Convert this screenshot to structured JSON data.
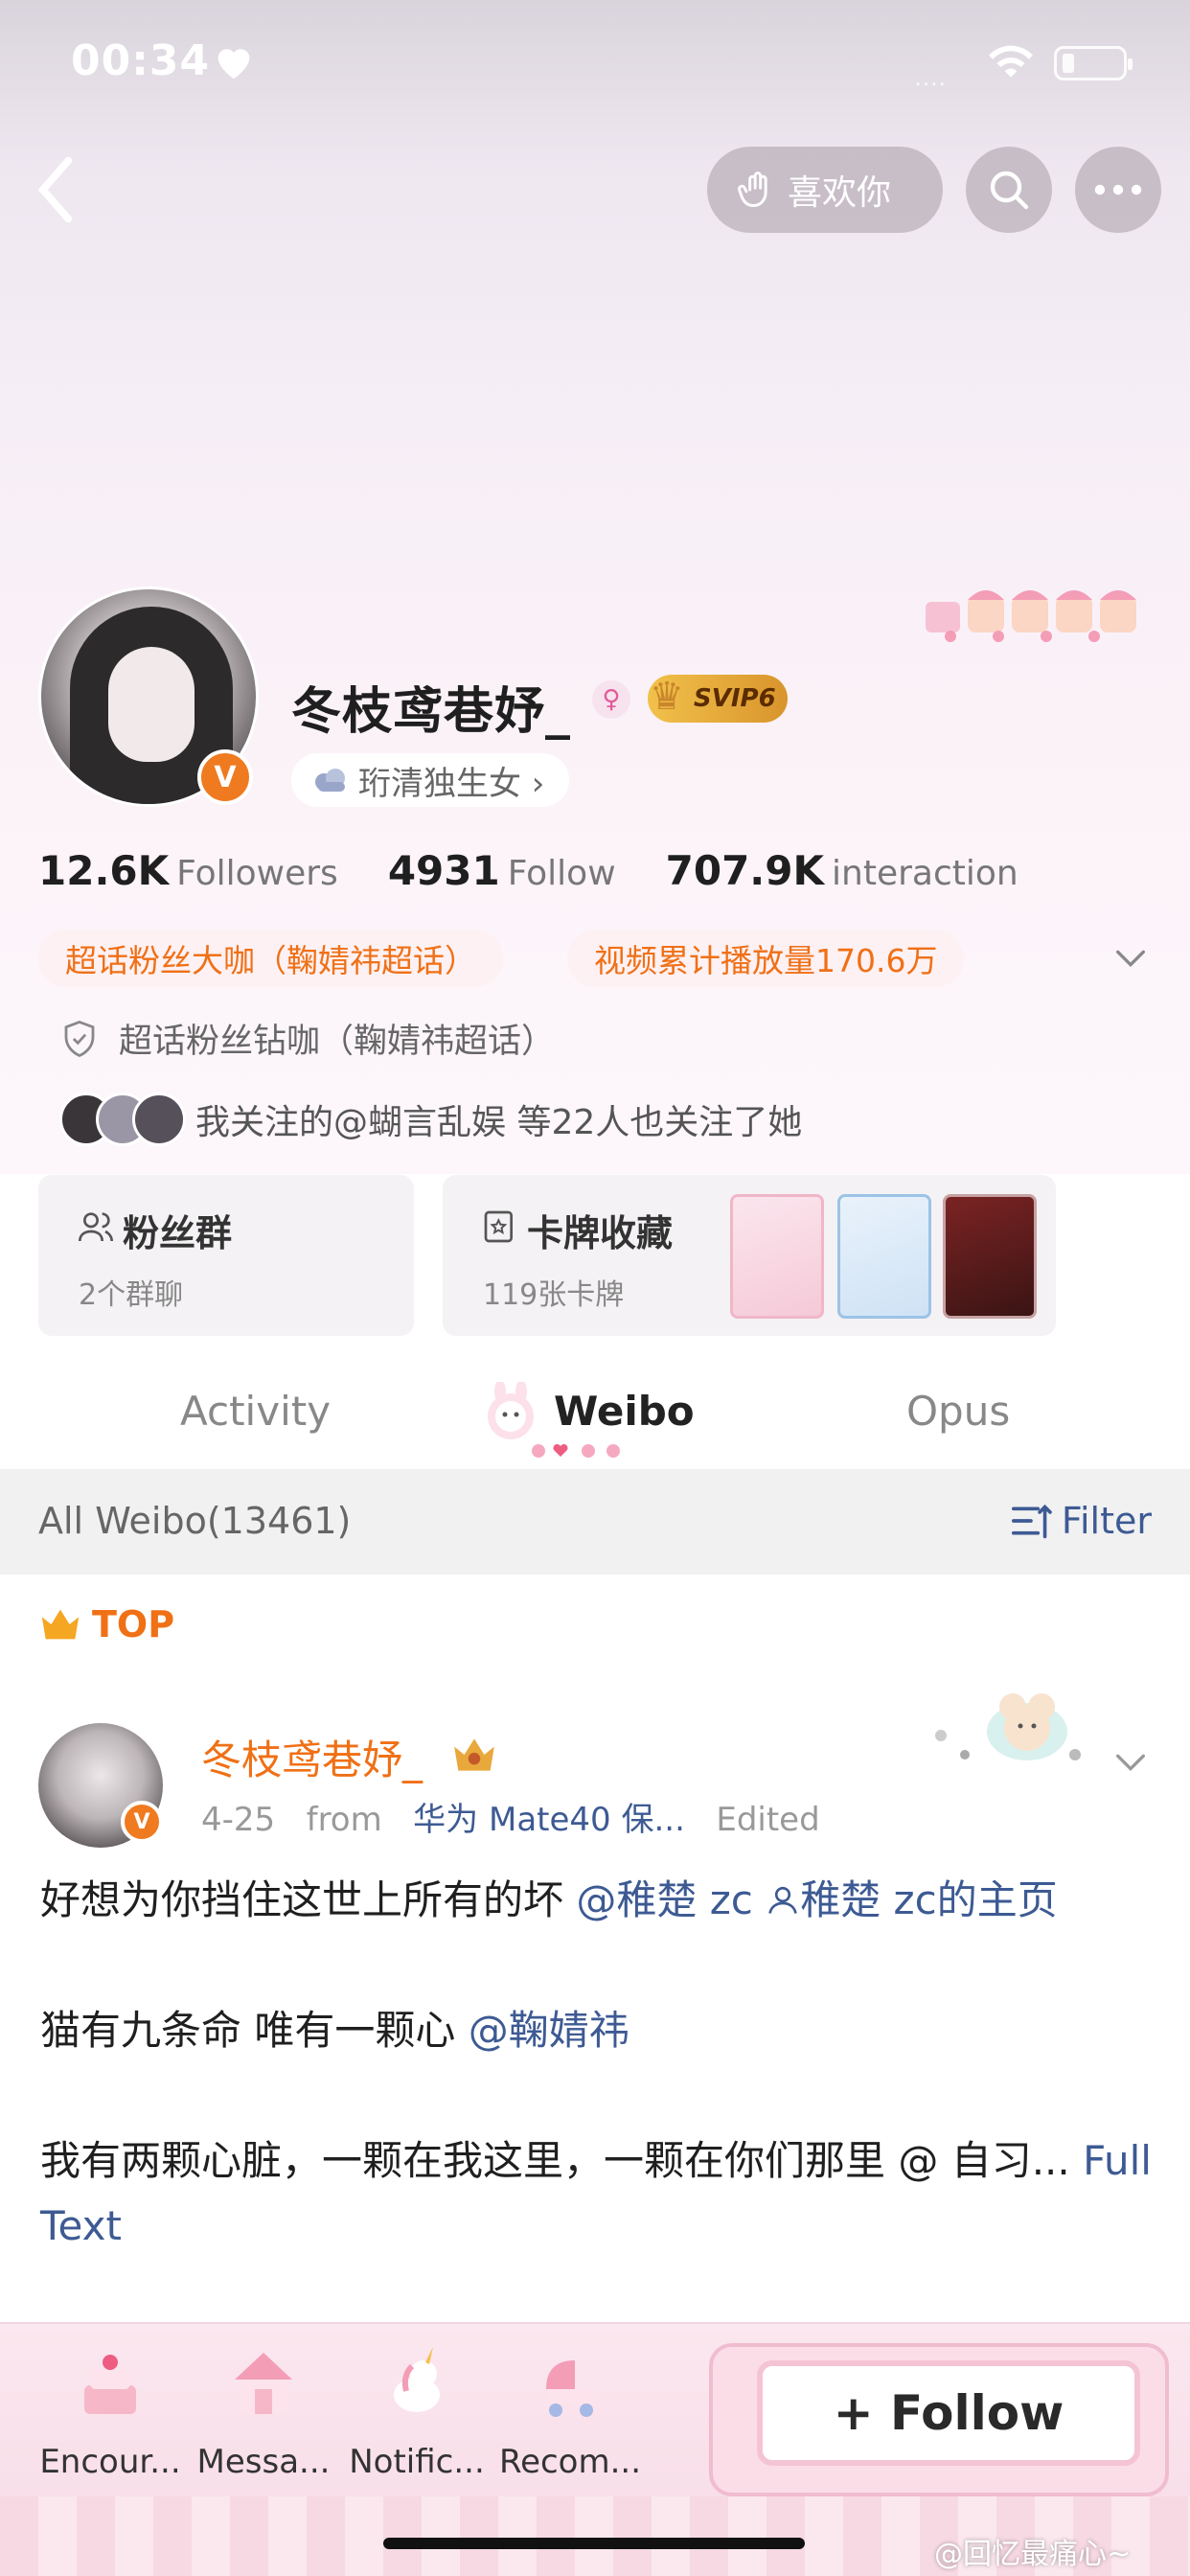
{
  "status_bar": {
    "time": "00:34",
    "signal": "....",
    "battery_level": "low"
  },
  "header": {
    "like_label": "喜欢你"
  },
  "profile": {
    "name": "冬枝鸢巷妤_",
    "gender_icon": "female-icon",
    "vip_label": "SVIP6",
    "tag": "珩清独生女 ›",
    "stats": [
      {
        "num": "12.6K",
        "label": "Followers"
      },
      {
        "num": "4931",
        "label": "Follow"
      },
      {
        "num": "707.9K",
        "label": "interaction"
      }
    ],
    "badges": [
      "超话粉丝大咖（鞠婧祎超话）",
      "视频累计播放量170.6万"
    ],
    "honor": "超话粉丝钻咖（鞠婧祎超话）",
    "common_follow": "我关注的@蝴言乱娱 等22人也关注了她"
  },
  "cards": {
    "fans_group": {
      "title": "粉丝群",
      "sub": "2个群聊"
    },
    "card_collection": {
      "title": "卡牌收藏",
      "sub": "119张卡牌"
    }
  },
  "tabs": {
    "activity": "Activity",
    "weibo": "Weibo",
    "opus": "Opus"
  },
  "filter_bar": {
    "all_label": "All Weibo(13461)",
    "filter_label": "Filter"
  },
  "post": {
    "top_label": "TOP",
    "author": "冬枝鸢巷妤_",
    "date": "4-25",
    "from_label": "from",
    "source": "华为 Mate40 保...",
    "edited": "Edited",
    "p1_text": "好想为你挡住这世上所有的坏 ",
    "p1_link": "@稚楚 zc ",
    "p1_link2": "稚楚 zc的主页",
    "p2_text": "猫有九条命 唯有一颗心 ",
    "p2_link": "@鞠婧祎",
    "p3_text": "我有两颗心脏，一颗在我这里，一颗在你们那里 @ 自习... ",
    "p3_link": "Full Text"
  },
  "bottom_bar": {
    "items": [
      "Encour...",
      "Messa...",
      "Notific...",
      "Recom..."
    ],
    "follow_label": "+ Follow"
  },
  "watermark": "@回忆最痛心~",
  "colors": {
    "accent": "#f07016",
    "link": "#3d5a93",
    "vip_gold": "#d9942c"
  }
}
